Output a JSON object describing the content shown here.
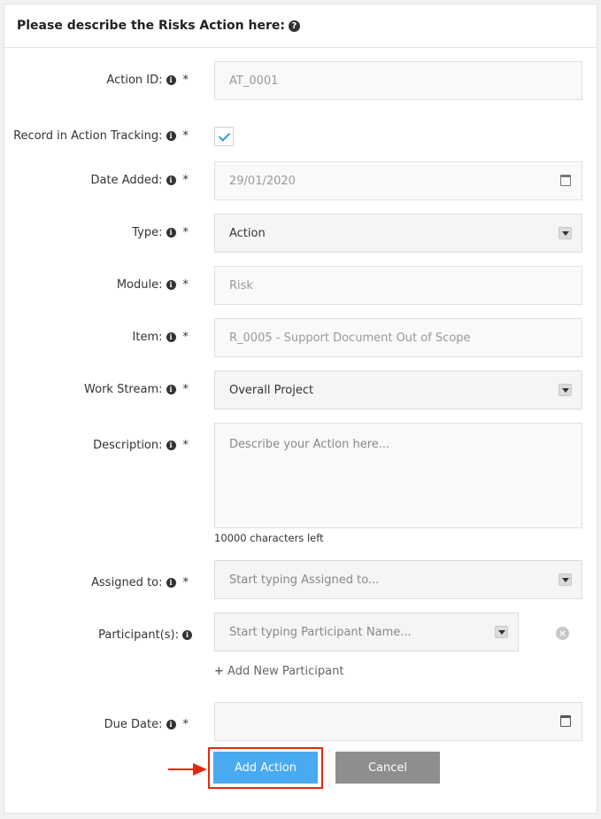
{
  "header": {
    "title": "Please describe the Risks Action here:"
  },
  "fields": {
    "action_id": {
      "label": "Action ID:",
      "value": "AT_0001"
    },
    "record": {
      "label": "Record in Action Tracking:",
      "checked": true
    },
    "date_added": {
      "label": "Date Added:",
      "value": "29/01/2020"
    },
    "type": {
      "label": "Type:",
      "value": "Action"
    },
    "module": {
      "label": "Module:",
      "value": "Risk"
    },
    "item": {
      "label": "Item:",
      "value": "R_0005 - Support Document Out of Scope"
    },
    "work_stream": {
      "label": "Work Stream:",
      "value": "Overall Project"
    },
    "description": {
      "label": "Description:",
      "placeholder": "Describe your Action here...",
      "chars_left": "10000 characters left"
    },
    "assigned": {
      "label": "Assigned to:",
      "placeholder": "Start typing Assigned to..."
    },
    "participants": {
      "label": "Participant(s):",
      "placeholder": "Start typing Participant Name...",
      "add_label": "Add New Participant"
    },
    "due_date": {
      "label": "Due Date:",
      "value": ""
    }
  },
  "required_mark": "*",
  "info_glyph": "i",
  "help_glyph": "?",
  "buttons": {
    "add": "Add Action",
    "cancel": "Cancel"
  },
  "colors": {
    "primary": "#4aaaf0",
    "cancel": "#8e8e8e",
    "highlight": "#e2290e",
    "check": "#2e9bd9"
  }
}
